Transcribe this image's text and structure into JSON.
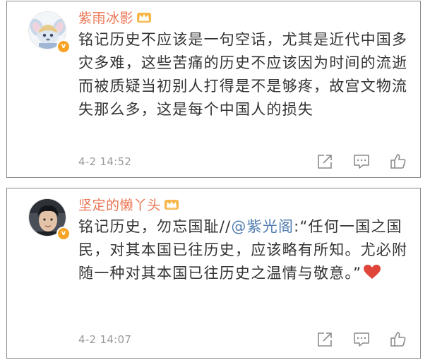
{
  "posts": [
    {
      "username": "紫雨冰影",
      "avatar_icon": "stitch-avatar",
      "badge": "v",
      "text": "铭记历史不应该是一句空话，尤其是近代中国多灾多难，这些苦痛的历史不应该因为时间的流逝而被质疑当初别人打得是不是够疼，故宫文物流失那么多，这是每个中国人的损失",
      "time": "4-2 14:52"
    },
    {
      "username": "坚定的懒丫头",
      "avatar_icon": "person-avatar",
      "badge": "v",
      "text_prefix": "铭记历史，勿忘国耻//",
      "mention": "@紫光阁",
      "text_suffix": ":“任何一国之国民，对其本国已往历史，应该略有所知。尤必附随一种对其本国已往历史之温情与敬意。”",
      "time": "4-2 14:07"
    }
  ],
  "colors": {
    "username": "#eb7350",
    "mention": "#507daf",
    "text": "#333333",
    "meta": "#9b9b9b",
    "heart": "#e0453a"
  },
  "icons": [
    "crown-icon",
    "share-icon",
    "comment-icon",
    "like-icon",
    "heart-emoji"
  ]
}
